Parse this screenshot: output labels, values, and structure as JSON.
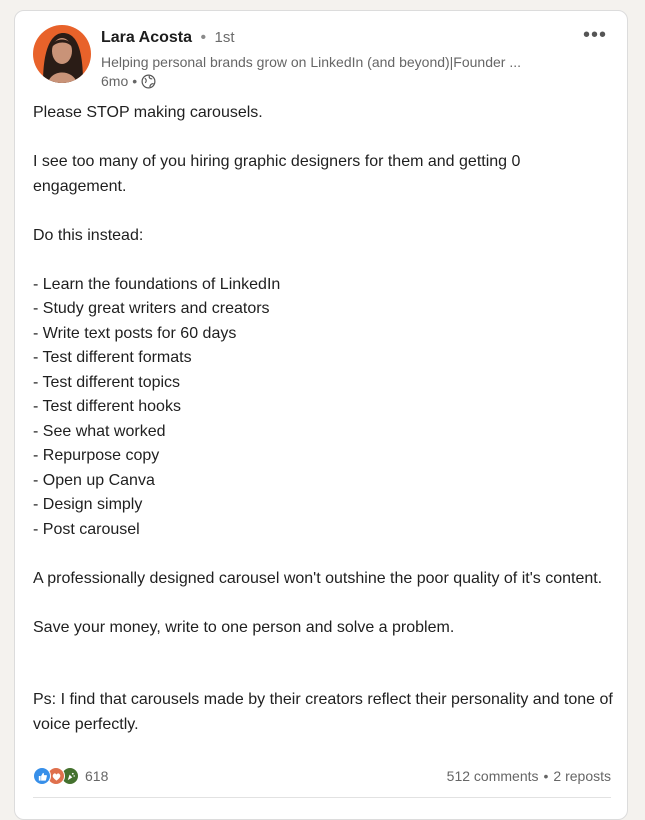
{
  "author": {
    "name": "Lara Acosta",
    "separator": "•",
    "degree": "1st",
    "headline": "Helping personal brands grow on LinkedIn (and beyond)|Founder ...",
    "time": "6mo",
    "visibility_icon": "globe-icon"
  },
  "menu": {
    "more_icon": "more-horizontal-icon",
    "more_label": "•••"
  },
  "post": {
    "intro": "Please STOP making carousels.",
    "p2": "I see too many of you hiring graphic designers for them and getting 0 engagement.",
    "p3": "Do this instead:",
    "steps": [
      "- Learn the foundations of LinkedIn",
      "- Study great writers and creators",
      "- Write text posts for 60 days",
      "- Test different formats",
      "- Test different topics",
      "- Test different hooks",
      "- See what worked",
      "- Repurpose copy",
      "- Open up Canva",
      "- Design simply",
      "- Post carousel"
    ],
    "p4": "A professionally designed carousel won't outshine the poor quality of it's content.",
    "p5": "Save your money, write to one person and solve a problem.",
    "p6": "Ps: I find that carousels made by their creators reflect their personality and tone of voice perfectly."
  },
  "social": {
    "reaction_icons": [
      "like-icon",
      "love-icon",
      "celebrate-icon"
    ],
    "reaction_count": "618",
    "comments": "512 comments",
    "dot": "•",
    "reposts": "2 reposts"
  },
  "colors": {
    "like": "#378fe9",
    "love": "#df704d",
    "celebrate": "#44712e",
    "muted_text": "#666666"
  }
}
